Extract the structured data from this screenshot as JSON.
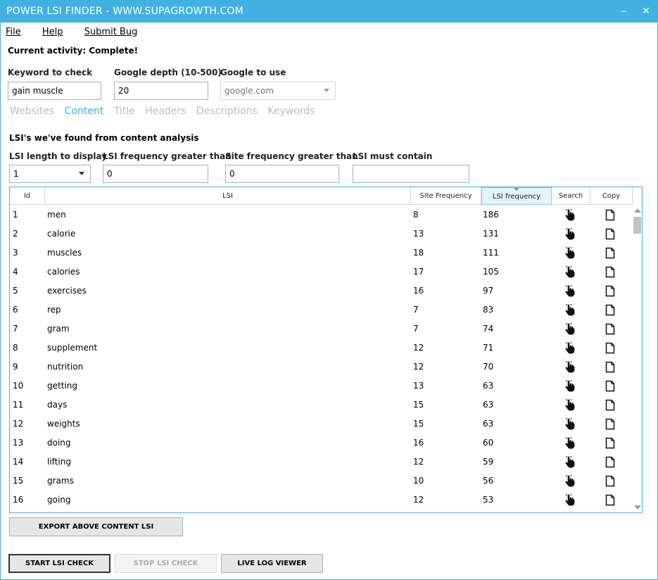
{
  "window": {
    "title": "POWER LSI FINDER - WWW.SUPAGROWTH.COM",
    "minimize_glyph": "‒",
    "close_glyph": "✕"
  },
  "menu": {
    "file": "File",
    "help": "Help",
    "submit_bug": "Submit Bug"
  },
  "status": {
    "activity": "Current activity: Complete!"
  },
  "form": {
    "keyword_label": "Keyword to check",
    "keyword_value": "gain muscle",
    "depth_label": "Google depth (10-500)",
    "depth_value": "20",
    "google_label": "Google to use",
    "google_value": "google.com"
  },
  "tabs": [
    "Websites",
    "Content",
    "Title",
    "Headers",
    "Descriptions",
    "Keywords"
  ],
  "active_tab": "Content",
  "content": {
    "section_title": "LSI's we've found from content analysis",
    "filters": {
      "length_label": "LSI length to display",
      "length_value": "1",
      "lsi_freq_label": "LSI frequency greater than",
      "lsi_freq_value": "0",
      "site_freq_label": "Site frequency greater than",
      "site_freq_value": "0",
      "must_contain_label": "LSI must contain",
      "must_contain_value": ""
    },
    "columns": [
      "Id",
      "LSI",
      "Site Frequency",
      "LSI frequency",
      "Search",
      "Copy"
    ],
    "sorted_column": "LSI frequency",
    "rows": [
      {
        "id": "1",
        "lsi": "men",
        "site": "8",
        "freq": "186"
      },
      {
        "id": "2",
        "lsi": "calorie",
        "site": "13",
        "freq": "131"
      },
      {
        "id": "3",
        "lsi": "muscles",
        "site": "18",
        "freq": "111"
      },
      {
        "id": "4",
        "lsi": "calories",
        "site": "17",
        "freq": "105"
      },
      {
        "id": "5",
        "lsi": "exercises",
        "site": "16",
        "freq": "97"
      },
      {
        "id": "6",
        "lsi": "rep",
        "site": "7",
        "freq": "83"
      },
      {
        "id": "7",
        "lsi": "gram",
        "site": "7",
        "freq": "74"
      },
      {
        "id": "8",
        "lsi": "supplement",
        "site": "12",
        "freq": "71"
      },
      {
        "id": "9",
        "lsi": "nutrition",
        "site": "12",
        "freq": "70"
      },
      {
        "id": "10",
        "lsi": "getting",
        "site": "13",
        "freq": "63"
      },
      {
        "id": "11",
        "lsi": "days",
        "site": "15",
        "freq": "63"
      },
      {
        "id": "12",
        "lsi": "weights",
        "site": "15",
        "freq": "63"
      },
      {
        "id": "13",
        "lsi": "doing",
        "site": "16",
        "freq": "60"
      },
      {
        "id": "14",
        "lsi": "lifting",
        "site": "12",
        "freq": "59"
      },
      {
        "id": "15",
        "lsi": "grams",
        "site": "10",
        "freq": "56"
      },
      {
        "id": "16",
        "lsi": "going",
        "site": "12",
        "freq": "53"
      }
    ],
    "export_button": "EXPORT ABOVE CONTENT LSI"
  },
  "buttons": {
    "start": "START LSI CHECK",
    "stop": "STOP LSI CHECK",
    "log": "LIVE LOG VIEWER"
  },
  "colors": {
    "accent": "#41b1e1",
    "tab_inactive": "#bcbcbc"
  }
}
